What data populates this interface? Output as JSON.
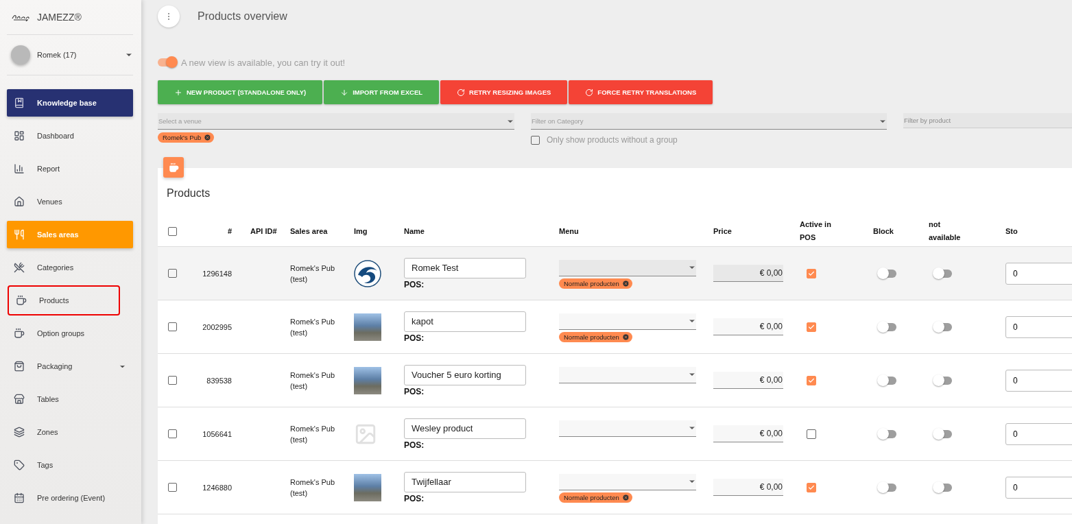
{
  "sidebar": {
    "brand": "JAMEZZ®",
    "user": "Romek (17)",
    "items": [
      {
        "label": "Knowledge base",
        "kind": "featured",
        "selected": false,
        "highlighted": false,
        "expandable": false
      },
      {
        "label": "Dashboard",
        "kind": "plain",
        "selected": false,
        "highlighted": false,
        "expandable": false
      },
      {
        "label": "Report",
        "kind": "plain",
        "selected": false,
        "highlighted": false,
        "expandable": false
      },
      {
        "label": "Venues",
        "kind": "plain",
        "selected": false,
        "highlighted": false,
        "expandable": false
      },
      {
        "label": "Sales areas",
        "kind": "plain",
        "selected": true,
        "highlighted": false,
        "expandable": false
      },
      {
        "label": "Categories",
        "kind": "plain",
        "selected": false,
        "highlighted": false,
        "expandable": false
      },
      {
        "label": "Products",
        "kind": "plain",
        "selected": false,
        "highlighted": true,
        "expandable": false
      },
      {
        "label": "Option groups",
        "kind": "plain",
        "selected": false,
        "highlighted": false,
        "expandable": false
      },
      {
        "label": "Packaging",
        "kind": "plain",
        "selected": false,
        "highlighted": false,
        "expandable": true
      },
      {
        "label": "Tables",
        "kind": "plain",
        "selected": false,
        "highlighted": false,
        "expandable": false
      },
      {
        "label": "Zones",
        "kind": "plain",
        "selected": false,
        "highlighted": false,
        "expandable": false
      },
      {
        "label": "Tags",
        "kind": "plain",
        "selected": false,
        "highlighted": false,
        "expandable": false
      },
      {
        "label": "Pre ordering (Event)",
        "kind": "plain",
        "selected": false,
        "highlighted": false,
        "expandable": false
      }
    ]
  },
  "header": {
    "title": "Products overview"
  },
  "new_view": {
    "on": true,
    "label": "A new view is available, you can try it out!"
  },
  "actions": [
    {
      "label": "NEW PRODUCT (STANDALONE ONLY)",
      "kind": "add",
      "color": "#4caf50"
    },
    {
      "label": "IMPORT FROM EXCEL",
      "kind": "import",
      "color": "#4caf50"
    },
    {
      "label": "RETRY RESIZING IMAGES",
      "kind": "retry",
      "color": "#f44336"
    },
    {
      "label": "FORCE RETRY TRANSLATIONS",
      "kind": "retry",
      "color": "#f44336"
    }
  ],
  "filters": {
    "venue": {
      "placeholder": "Select a venue",
      "chips": [
        "Romek's Pub"
      ]
    },
    "category": {
      "placeholder": "Filter on Category"
    },
    "no_group": {
      "label": "Only show products without a group",
      "checked": false
    },
    "product": {
      "placeholder": "Filter by product"
    }
  },
  "table": {
    "title": "Products",
    "select_all": false,
    "columns": [
      "#",
      "API ID#",
      "Sales area",
      "Img",
      "Name",
      "Menu",
      "Price",
      "Active in POS",
      "Block",
      "not available",
      "Sto"
    ],
    "rows": [
      {
        "selected": false,
        "highlighted": true,
        "id": "1296148",
        "sales_area": "Romek's Pub (test)",
        "kind": "logo",
        "name": "Romek Test",
        "pos": "POS:",
        "menu_chips": [
          "Normale producten"
        ],
        "price": "€ 0,00",
        "active": true,
        "block": false,
        "not_available": false,
        "stock": "0"
      },
      {
        "selected": false,
        "highlighted": false,
        "id": "2002995",
        "sales_area": "Romek's Pub (test)",
        "kind": "photo",
        "name": "kapot",
        "pos": "POS:",
        "menu_chips": [
          "Normale producten"
        ],
        "price": "€ 0,00",
        "active": true,
        "block": false,
        "not_available": false,
        "stock": "0"
      },
      {
        "selected": false,
        "highlighted": false,
        "id": "839538",
        "sales_area": "Romek's Pub (test)",
        "kind": "photo",
        "name": "Voucher 5 euro korting",
        "pos": "POS:",
        "menu_chips": [],
        "price": "€ 0,00",
        "active": true,
        "block": false,
        "not_available": false,
        "stock": "0"
      },
      {
        "selected": false,
        "highlighted": false,
        "id": "1056641",
        "sales_area": "Romek's Pub (test)",
        "kind": "none",
        "name": "Wesley product",
        "pos": "POS:",
        "menu_chips": [],
        "price": "€ 0,00",
        "active": false,
        "block": false,
        "not_available": false,
        "stock": "0"
      },
      {
        "selected": false,
        "highlighted": false,
        "id": "1246880",
        "sales_area": "Romek's Pub (test)",
        "kind": "photo",
        "name": "Twijfellaar",
        "pos": "POS:",
        "menu_chips": [
          "Normale producten"
        ],
        "price": "€ 0,00",
        "active": true,
        "block": false,
        "not_available": false,
        "stock": "0"
      }
    ]
  }
}
